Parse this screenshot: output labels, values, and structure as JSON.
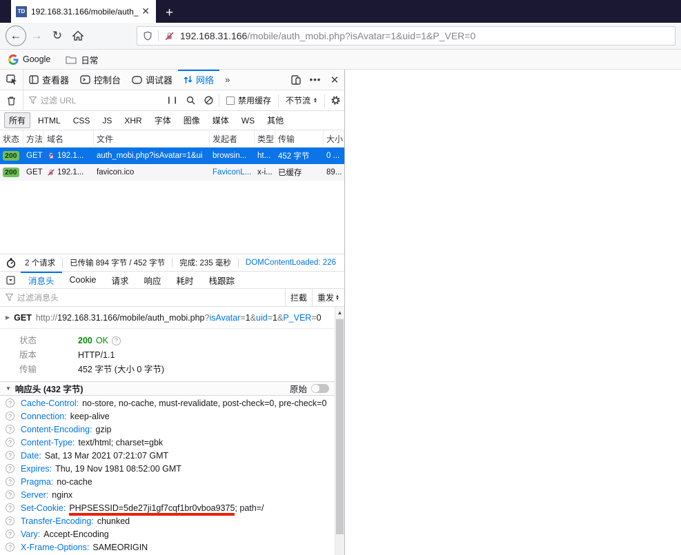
{
  "browser": {
    "tab": {
      "favicon_text": "TD",
      "title": "192.168.31.166/mobile/auth_"
    },
    "new_tab": "+",
    "url": {
      "domain": "192.168.31.166",
      "path": "/mobile/auth_mobi.php?isAvatar=1&uid=1&P_VER=0"
    },
    "bookmarks": {
      "google": "Google",
      "folder": "日常"
    }
  },
  "devtools": {
    "tabs": [
      "查看器",
      "控制台",
      "调试器",
      "网络"
    ],
    "network": {
      "filter_placeholder": "过滤 URL",
      "disable_cache_label": "禁用缓存",
      "throttle_label": "不节流",
      "type_filters": [
        "所有",
        "HTML",
        "CSS",
        "JS",
        "XHR",
        "字体",
        "图像",
        "媒体",
        "WS",
        "其他"
      ],
      "active_type_filter": 0,
      "columns": [
        "状态",
        "方法",
        "域名",
        "文件",
        "发起者",
        "类型",
        "传输",
        "大小"
      ],
      "requests": [
        {
          "status": "200",
          "method": "GET",
          "domain": "192.1...",
          "file": "auth_mobi.php?isAvatar=1&ui",
          "initiator": "browsin...",
          "initiator_link": false,
          "type": "ht...",
          "transferred": "452 字节",
          "size": "0 ...",
          "selected": true
        },
        {
          "status": "200",
          "method": "GET",
          "domain": "192.1...",
          "file": "favicon.ico",
          "initiator": "FaviconL...",
          "initiator_link": true,
          "type": "x-i...",
          "transferred": "已缓存",
          "size": "89...",
          "selected": false
        }
      ],
      "summary": [
        {
          "text": "2 个请求",
          "accent": false
        },
        {
          "text": "已传输 894 字节 / 452 字节",
          "accent": false
        },
        {
          "text": "完成: 235 毫秒",
          "accent": false
        },
        {
          "text": "DOMContentLoaded: 226",
          "accent": true
        }
      ]
    },
    "details": {
      "tabs": [
        "消息头",
        "Cookie",
        "请求",
        "响应",
        "耗时",
        "栈跟踪"
      ],
      "active_tab": 0,
      "filter_placeholder": "过滤消息头",
      "block_label": "拦截",
      "resend_label": "重发",
      "request_line": {
        "method": "GET",
        "scheme": "http://",
        "url_base": "192.168.31.166/mobile/auth_mobi.php",
        "query": [
          {
            "sep": "?",
            "key": "isAvatar",
            "eq": "=",
            "val": "1"
          },
          {
            "sep": "&",
            "key": "uid",
            "eq": "=",
            "val": "1"
          },
          {
            "sep": "&",
            "key": "P_VER",
            "eq": "=",
            "val": "0"
          }
        ]
      },
      "status_row": {
        "label": "状态",
        "code": "200",
        "text": "OK"
      },
      "version_row": {
        "label": "版本",
        "value": "HTTP/1.1"
      },
      "transferred_row": {
        "label": "传输",
        "value": "452 字节 (大小 0 字节)"
      },
      "response_headers_title": "响应头 (432 字节)",
      "raw_label": "原始",
      "headers": [
        {
          "name": "Cache-Control",
          "value": "no-store, no-cache, must-revalidate, post-check=0, pre-check=0"
        },
        {
          "name": "Connection",
          "value": "keep-alive"
        },
        {
          "name": "Content-Encoding",
          "value": "gzip"
        },
        {
          "name": "Content-Type",
          "value": "text/html; charset=gbk"
        },
        {
          "name": "Date",
          "value": "Sat, 13 Mar 2021 07:21:07 GMT"
        },
        {
          "name": "Expires",
          "value": "Thu, 19 Nov 1981 08:52:00 GMT"
        },
        {
          "name": "Pragma",
          "value": "no-cache"
        },
        {
          "name": "Server",
          "value": "nginx"
        },
        {
          "name": "Set-Cookie",
          "value_highlight": "PHPSESSID=5de27ji1gf7cqf1br0vboa9375",
          "value_rest": "; path=/"
        },
        {
          "name": "Transfer-Encoding",
          "value": "chunked"
        },
        {
          "name": "Vary",
          "value": "Accept-Encoding"
        },
        {
          "name": "X-Frame-Options",
          "value": "SAMEORIGIN"
        }
      ]
    }
  }
}
